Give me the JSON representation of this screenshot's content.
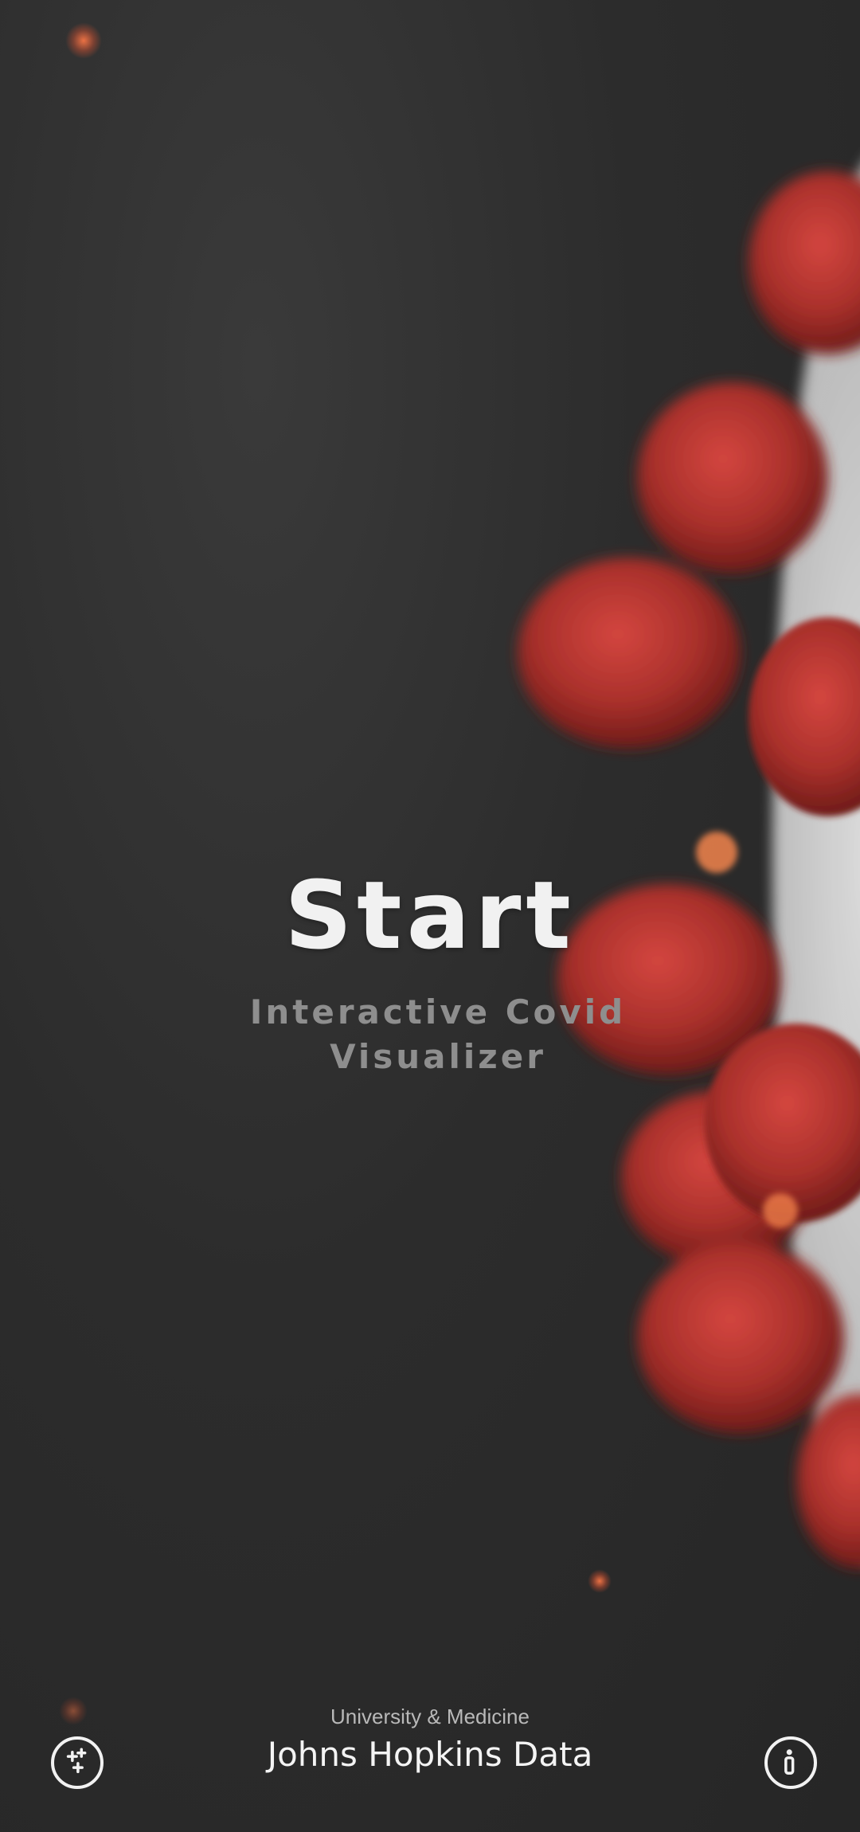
{
  "main": {
    "start_label": "Start",
    "subtitle": "Interactive Covid Visualizer"
  },
  "footer": {
    "caption": "University & Medicine",
    "title": "Johns Hopkins Data",
    "left_icon": "sparkles-icon",
    "right_icon": "info-icon"
  },
  "colors": {
    "background": "#2f2f2f",
    "virus_red": "#b8322f",
    "virus_core": "#d9d9d9",
    "accent_glow": "#ff7a45"
  }
}
